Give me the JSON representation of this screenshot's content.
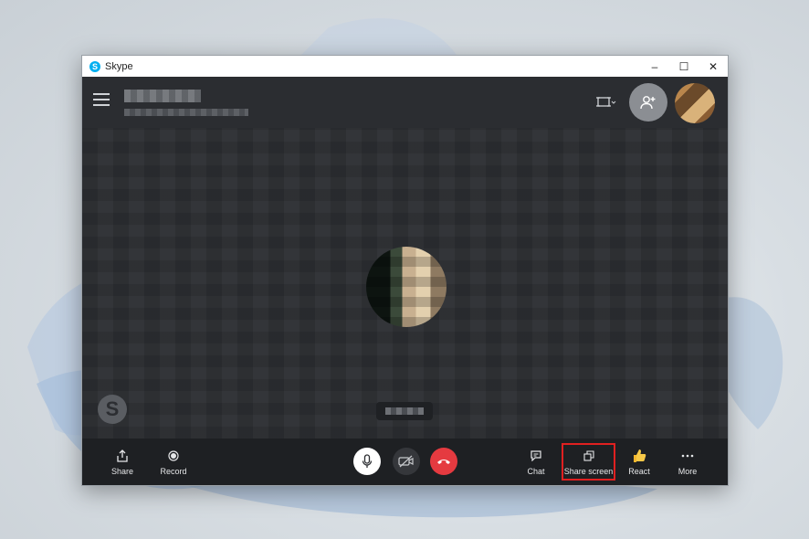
{
  "window": {
    "title": "Skype",
    "controls": {
      "minimize": "–",
      "maximize": "☐",
      "close": "✕"
    }
  },
  "watermark": {
    "letter": "S"
  },
  "toolbar": {
    "share_label": "Share",
    "record_label": "Record",
    "chat_label": "Chat",
    "share_screen_label": "Share screen",
    "react_label": "React",
    "more_label": "More"
  },
  "colors": {
    "accent": "#00aff0",
    "end_call": "#e53a40",
    "highlight": "#e02020"
  },
  "icons": {
    "menu": "hamburger-icon",
    "fit": "fit-to-window-icon",
    "add": "add-person-icon",
    "share": "share-icon",
    "record": "record-icon",
    "mic": "microphone-icon",
    "camera": "camera-off-icon",
    "end": "end-call-icon",
    "chat": "chat-icon",
    "share_screen": "share-screen-icon",
    "react": "thumbs-up-icon",
    "more": "more-icon"
  }
}
